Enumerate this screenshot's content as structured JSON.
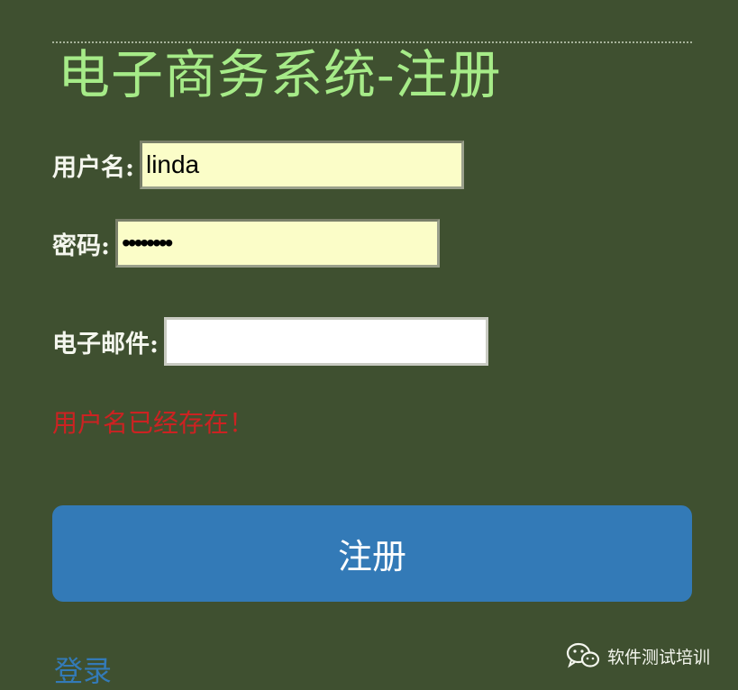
{
  "page": {
    "title": "电子商务系统-注册"
  },
  "form": {
    "username": {
      "label": "用户名:",
      "value": "linda"
    },
    "password": {
      "label": "密码:",
      "value": "secret12"
    },
    "email": {
      "label": "电子邮件:",
      "value": ""
    },
    "error_message": "用户名已经存在！",
    "submit_label": "注册"
  },
  "login_link": "登录",
  "watermark": {
    "icon": "wechat-icon",
    "text": "软件测试培训"
  },
  "colors": {
    "background": "#3f5030",
    "title": "#a6eb88",
    "input_highlight": "#fbfdc8",
    "error": "#cc2222",
    "primary_button": "#337ab7",
    "link": "#337ab7"
  }
}
